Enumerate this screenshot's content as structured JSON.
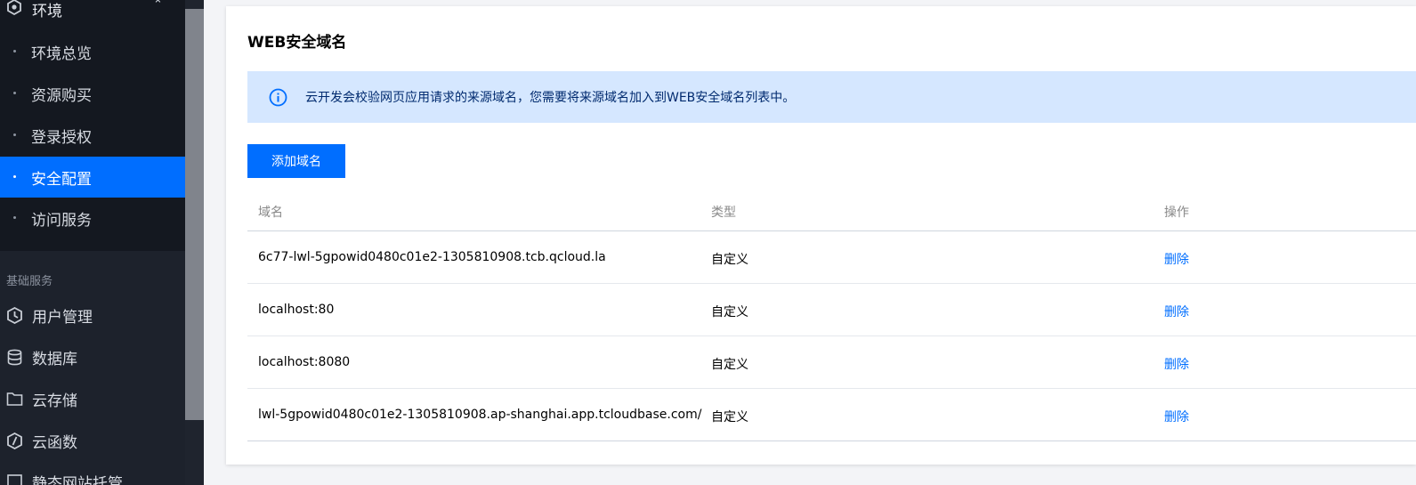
{
  "sidebar": {
    "env": {
      "label": "环境",
      "icon": "hexagon-icon",
      "chevron": "^"
    },
    "env_items": [
      {
        "label": "环境总览",
        "active": false
      },
      {
        "label": "资源购买",
        "active": false
      },
      {
        "label": "登录授权",
        "active": false
      },
      {
        "label": "安全配置",
        "active": true
      },
      {
        "label": "访问服务",
        "active": false
      }
    ],
    "group_title": "基础服务",
    "main_items": [
      {
        "label": "用户管理",
        "icon": "user-shield-icon"
      },
      {
        "label": "数据库",
        "icon": "database-icon"
      },
      {
        "label": "云存储",
        "icon": "folder-icon"
      },
      {
        "label": "云函数",
        "icon": "function-icon"
      },
      {
        "label": "静态网站托管",
        "icon": "web-icon"
      }
    ]
  },
  "content": {
    "title": "WEB安全域名",
    "notice": "云开发会校验网页应用请求的来源域名，您需要将来源域名加入到WEB安全域名列表中。",
    "add_button": "添加域名",
    "table": {
      "headers": [
        "域名",
        "类型",
        "操作"
      ],
      "rows": [
        {
          "domain": "6c77-lwl-5gpowid0480c01e2-1305810908.tcb.qcloud.la",
          "type": "自定义",
          "action": "删除"
        },
        {
          "domain": "localhost:80",
          "type": "自定义",
          "action": "删除"
        },
        {
          "domain": "localhost:8080",
          "type": "自定义",
          "action": "删除"
        },
        {
          "domain": "lwl-5gpowid0480c01e2-1305810908.ap-shanghai.app.tcloudbase.com/",
          "type": "自定义",
          "action": "删除"
        }
      ]
    }
  },
  "colors": {
    "primary": "#006eff",
    "sidebar_bg": "#1d222c",
    "notice_bg": "#d5e7ff"
  }
}
